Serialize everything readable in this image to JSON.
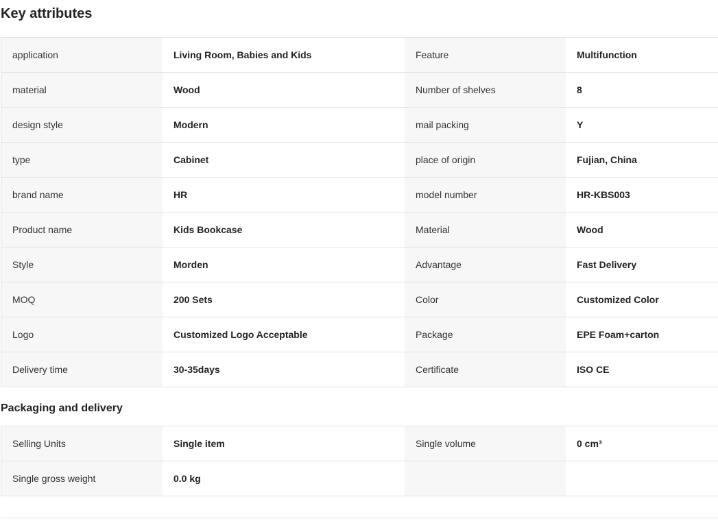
{
  "key_attributes": {
    "title": "Key attributes",
    "rows": [
      [
        {
          "label": "application",
          "value": "Living Room, Babies and Kids"
        },
        {
          "label": "Feature",
          "value": "Multifunction"
        }
      ],
      [
        {
          "label": "material",
          "value": "Wood"
        },
        {
          "label": "Number of shelves",
          "value": "8"
        }
      ],
      [
        {
          "label": "design style",
          "value": "Modern"
        },
        {
          "label": "mail packing",
          "value": "Y"
        }
      ],
      [
        {
          "label": "type",
          "value": "Cabinet"
        },
        {
          "label": "place of origin",
          "value": "Fujian, China"
        }
      ],
      [
        {
          "label": "brand name",
          "value": "HR"
        },
        {
          "label": "model number",
          "value": "HR-KBS003"
        }
      ],
      [
        {
          "label": "Product name",
          "value": "Kids Bookcase"
        },
        {
          "label": "Material",
          "value": "Wood"
        }
      ],
      [
        {
          "label": "Style",
          "value": "Morden"
        },
        {
          "label": "Advantage",
          "value": "Fast Delivery"
        }
      ],
      [
        {
          "label": "MOQ",
          "value": "200 Sets"
        },
        {
          "label": "Color",
          "value": "Customized Color"
        }
      ],
      [
        {
          "label": "Logo",
          "value": "Customized Logo Acceptable"
        },
        {
          "label": "Package",
          "value": "EPE Foam+carton"
        }
      ],
      [
        {
          "label": "Delivery time",
          "value": "30-35days"
        },
        {
          "label": "Certificate",
          "value": "ISO CE"
        }
      ]
    ]
  },
  "packaging_delivery": {
    "title": "Packaging and delivery",
    "rows": [
      [
        {
          "label": "Selling Units",
          "value": "Single item"
        },
        {
          "label": "Single volume",
          "value": "0 cm³"
        }
      ],
      [
        {
          "label": "Single gross weight",
          "value": "0.0 kg"
        },
        {
          "label": "",
          "value": ""
        }
      ]
    ]
  }
}
